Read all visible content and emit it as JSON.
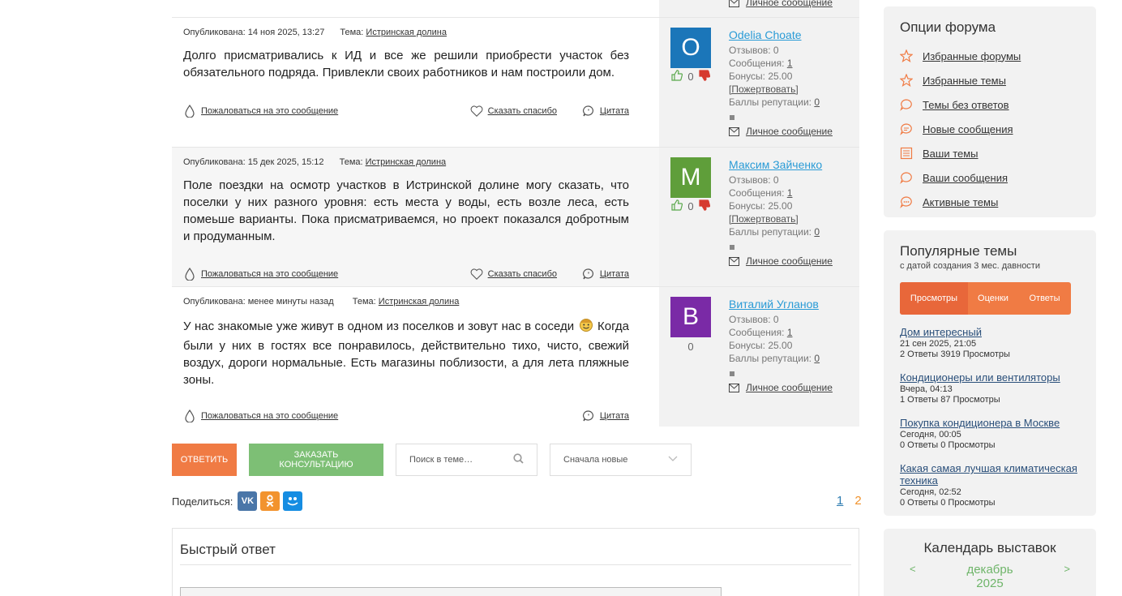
{
  "posts": [
    {
      "published_label": "Опубликована:",
      "published_date": "14 ноя 2025, 13:27",
      "topic_label": "Тема:",
      "topic": "Истринская долина",
      "text": "Долго присматривались к ИД и все же решили приобрести участок без обязательного подряда. Привлекли своих работников и нам построили дом.",
      "report": "Пожаловаться на это сообщение",
      "thanks": "Сказать спасибо",
      "quote": "Цитата",
      "author": {
        "initial": "O",
        "avatar_color": "#1b76b9",
        "name": "Odelia Choate",
        "votes": "0",
        "reviews": "Отзывов: 0",
        "messages_label": "Сообщения:",
        "messages": "1",
        "bonus": "Бонусы: 25.00",
        "donate": "[Пожертвовать]",
        "rep_label": "Баллы репутации:",
        "rep": "0",
        "pm": "Личное сообщение"
      }
    },
    {
      "published_label": "Опубликована:",
      "published_date": "15 дек 2025, 15:12",
      "topic_label": "Тема:",
      "topic": "Истринская долина",
      "text": "Поле поездки на осмотр участков в Истринской долине могу сказать, что поселки у них разного уровня: есть места у воды, есть возле леса, есть помеьше варианты. Пока присматриваемся, но проект показался добротным и продуманным.",
      "report": "Пожаловаться на это сообщение",
      "thanks": "Сказать спасибо",
      "quote": "Цитата",
      "author": {
        "initial": "М",
        "avatar_color": "#5f9e3a",
        "name": "Максим Зайченко",
        "votes": "0",
        "reviews": "Отзывов: 0",
        "messages_label": "Сообщения:",
        "messages": "1",
        "bonus": "Бонусы: 25.00",
        "donate": "[Пожертвовать]",
        "rep_label": "Баллы репутации:",
        "rep": "0",
        "pm": "Личное сообщение"
      }
    },
    {
      "published_label": "Опубликована:",
      "published_date": "менее минуты назад",
      "topic_label": "Тема:",
      "topic": "Истринская долина",
      "text_before": "У нас знакомые уже живут в одном из поселков и зовут нас в соседи",
      "text_after": "Когда были у них в гостях все понравилось, действительно тихо, чисто, свежий воздух, дороги нормальные. Есть магазины поблизости, а для лета пляжные зоны.",
      "report": "Пожаловаться на это сообщение",
      "quote": "Цитата",
      "author": {
        "initial": "В",
        "avatar_color": "#7a2aa6",
        "name": "Виталий Угланов",
        "votes": "0",
        "reviews": "Отзывов: 0",
        "messages_label": "Сообщения:",
        "messages": "1",
        "bonus": "Бонусы: 25.00",
        "rep_label": "Баллы репутации:",
        "rep": "0",
        "pm": "Личное сообщение"
      }
    }
  ],
  "prev_post_pm": "Личное сообщение",
  "reply_bar": {
    "reply": "Ответить",
    "consult": "Заказать консультацию",
    "search_placeholder": "Поиск в теме…",
    "sort": "Сначала новые"
  },
  "share": {
    "label": "Поделиться:"
  },
  "pager": {
    "p1": "1",
    "p2": "2"
  },
  "quick_reply": {
    "title": "Быстрый ответ"
  },
  "forum_options": {
    "title": "Опции форума",
    "items": [
      {
        "label": "Избранные форумы",
        "icon": "star-icon"
      },
      {
        "label": "Избранные темы",
        "icon": "star-icon"
      },
      {
        "label": "Темы без ответов",
        "icon": "chat-bubble-icon"
      },
      {
        "label": "Новые сообщения",
        "icon": "chat-dots-icon"
      },
      {
        "label": "Ваши темы",
        "icon": "list-icon"
      },
      {
        "label": "Ваши сообщения",
        "icon": "chat-bubble-icon"
      },
      {
        "label": "Активные темы",
        "icon": "chat-double-icon"
      }
    ]
  },
  "popular": {
    "title": "Популярные темы",
    "subtitle": "с датой создания 3 мес. давности",
    "tabs": [
      "Просмотры",
      "Оценки",
      "Ответы"
    ],
    "items": [
      {
        "title": "Дом интересный",
        "date": "21 сен 2025, 21:05",
        "stats": "2 Ответы 3919 Просмотры"
      },
      {
        "title": "Кондиционеры или вентиляторы",
        "date": "Вчера, 04:13",
        "stats": "1 Ответы 87 Просмотры"
      },
      {
        "title": "Покупка кондиционера в Москве",
        "date": "Сегодня, 00:05",
        "stats": "0 Ответы 0 Просмотры"
      },
      {
        "title": "Какая самая лучшая климатическая техника",
        "date": "Сегодня, 02:52",
        "stats": "0 Ответы 0 Просмотры"
      }
    ]
  },
  "calendar": {
    "title": "Календарь выставок",
    "month": "декабрь",
    "year": "2025",
    "prev": "<",
    "next": ">"
  },
  "colors": {
    "accent_orange": "#f07b44",
    "accent_green": "#7dbf75",
    "link_blue": "#2a9bd6"
  }
}
